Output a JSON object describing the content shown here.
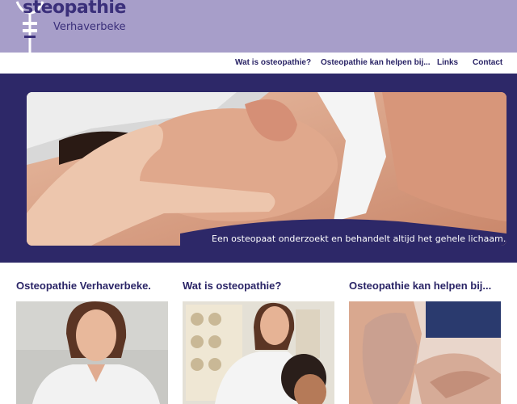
{
  "brand": {
    "title": "steopathie",
    "subtitle": "Verhaverbeke"
  },
  "nav": {
    "items": [
      {
        "label": "Wat is osteopathie?"
      },
      {
        "label": "Osteopathie kan helpen bij..."
      },
      {
        "label": "Links"
      },
      {
        "label": "Contact"
      }
    ]
  },
  "hero": {
    "caption": "Een osteopaat onderzoekt en behandelt altijd het gehele lichaam."
  },
  "columns": [
    {
      "title": "Osteopathie Verhaverbeke."
    },
    {
      "title": "Wat is osteopathie?"
    },
    {
      "title": "Osteopathie kan helpen bij..."
    }
  ],
  "colors": {
    "header_bg": "#a79ec9",
    "brand_text": "#3a2f7a",
    "band_bg": "#2d2868",
    "nav_text": "#2a2466"
  }
}
